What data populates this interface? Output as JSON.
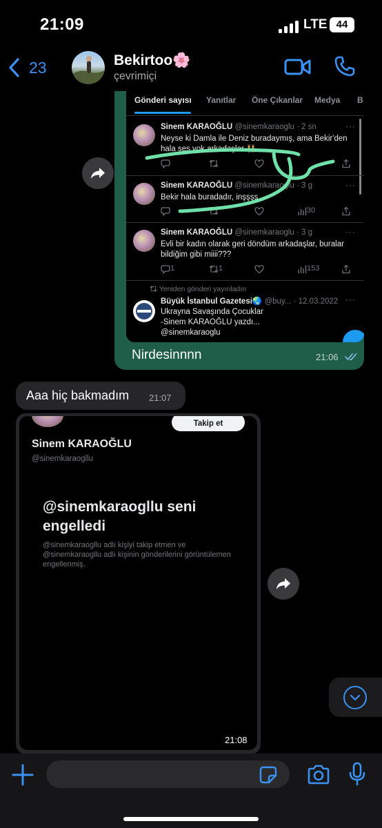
{
  "status_bar": {
    "time": "21:09",
    "network": "LTE",
    "battery": "44"
  },
  "header": {
    "back_count": "23",
    "contact_name": "Bekirtoo🌸",
    "contact_status": "çevrimiçi"
  },
  "messages": [
    {
      "direction": "outgoing",
      "text": "Nirdesinnnn",
      "time": "21:06",
      "read": true,
      "screenshot": {
        "tabs": [
          "Gönderi sayısı",
          "Yanıtlar",
          "Öne Çıkanlar",
          "Medya",
          "B"
        ],
        "tweets": [
          {
            "name": "Sinem KARAOĞLU",
            "handle": "@sinemkaraoglu",
            "age": "· 2 sn",
            "text": "Neyse ki Damla ile Deniz buradaymış, ama Bekir'den hala ses yok arkadaşlar 👯",
            "replies": "",
            "retweets": "",
            "views": ""
          },
          {
            "name": "Sinem KARAOĞLU",
            "handle": "@sinemkaraoglu",
            "age": "· 3 g",
            "text": "Bekir hala buradadır, inşşşş",
            "replies": "",
            "retweets": "",
            "views": "30"
          },
          {
            "name": "Sinem KARAOĞLU",
            "handle": "@sinemkaraoglu",
            "age": "· 3 g",
            "text": "Evli bir kadın olarak geri döndüm arkadaşlar, buralar bildiğim gibi miiii???",
            "replies": "1",
            "retweets": "1",
            "views": "153"
          },
          {
            "retweet_note": "Yeniden gönderi yayınladın",
            "name": "Büyük İstanbul Gazetesi🌏",
            "handle": "@buy...",
            "age": "· 12.03.2022",
            "text": "Ukrayna Savaşında Çocuklar\n-Sinem KARAOĞLU yazdı...\n@sinemkaraoglu"
          }
        ]
      }
    },
    {
      "direction": "incoming",
      "text": "Aaa hiç bakmadım",
      "time": "21:07"
    },
    {
      "direction": "incoming",
      "type": "image",
      "time": "21:08",
      "screenshot": {
        "follow_label": "Takip et",
        "name": "Sinem KARAOĞLU",
        "handle": "@sinemkaraogllu",
        "title": "@sinemkaraogllu seni engelledi",
        "body": "@sinemkaraogllu adlı kişiyi takip etmen ve @sinemkaraogllu adlı kişinin gönderilerini görüntülemen engellenmiş."
      }
    }
  ],
  "composer": {
    "placeholder": ""
  },
  "colors": {
    "accent": "#3b92f2",
    "outgoing_bubble": "#1f5e48",
    "incoming_bubble": "#262628",
    "annotation": "#6ee0a8",
    "twitter_blue": "#1d9bf0"
  },
  "icons": [
    "chevron-left-icon",
    "video-icon",
    "phone-icon",
    "forward-icon",
    "reply-icon",
    "retweet-icon",
    "like-icon",
    "views-icon",
    "share-icon",
    "chevron-down-icon",
    "plus-icon",
    "sticker-icon",
    "camera-icon",
    "mic-icon"
  ]
}
